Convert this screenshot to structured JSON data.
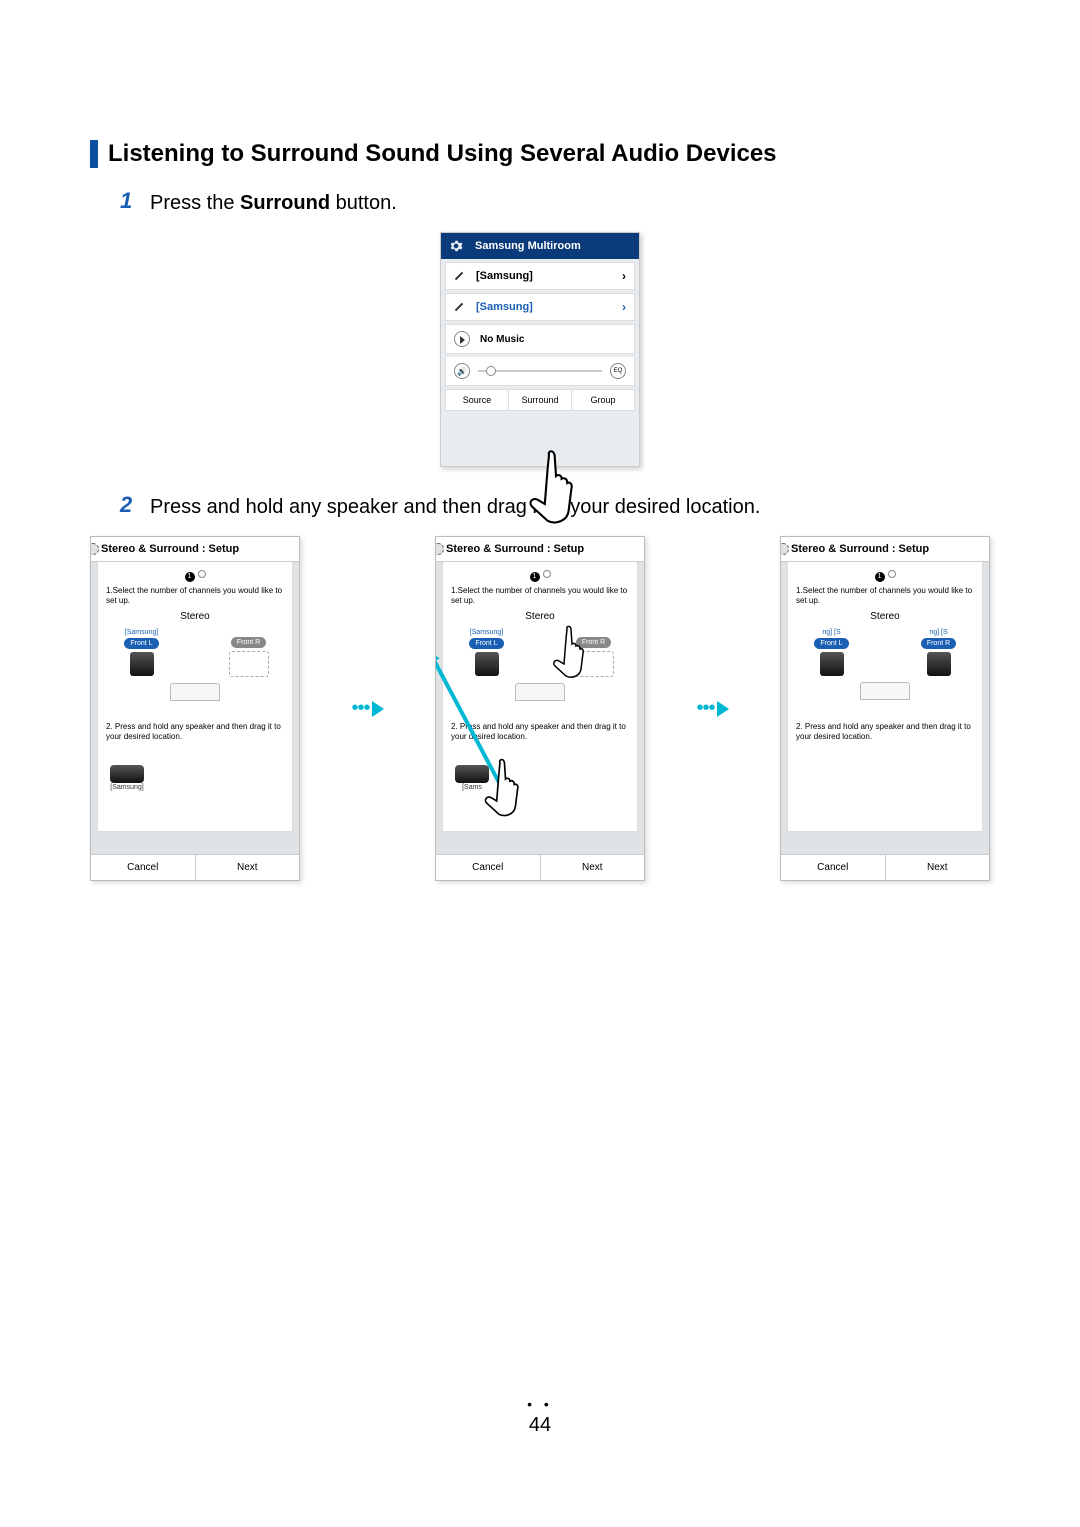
{
  "title": "Listening to Surround Sound Using Several Audio Devices",
  "steps": {
    "s1_num": "1",
    "s1_a": "Press the ",
    "s1_b": "Surround",
    "s1_c": " button.",
    "s2_num": "2",
    "s2": "Press and hold any speaker and then drag it to your desired location."
  },
  "phone1": {
    "header": "Samsung Multiroom",
    "row1": "[Samsung]",
    "row2": "[Samsung]",
    "no_music": "No Music",
    "eq": "EQ",
    "source": "Source",
    "surround": "Surround",
    "group": "Group"
  },
  "setup": {
    "title": "Stereo & Surround : Setup",
    "step1": "1.Select the number of channels you would like to set up.",
    "stereo": "Stereo",
    "samsung_label": "[Samsung]",
    "front_l": "Front L",
    "front_r": "Front R",
    "step2": "2. Press and hold any speaker and then drag it to your desired location.",
    "step2_b": "2. Press and hold any speaker and then drag it to your desired location.",
    "spk_bottom": "[Samsung]",
    "spk_bottom2": "[Sams",
    "cancel": "Cancel",
    "next": "Next",
    "panel3_lbl_l": "ng]   [S",
    "panel3_lbl_r": "ng]   [S"
  },
  "page": "44"
}
